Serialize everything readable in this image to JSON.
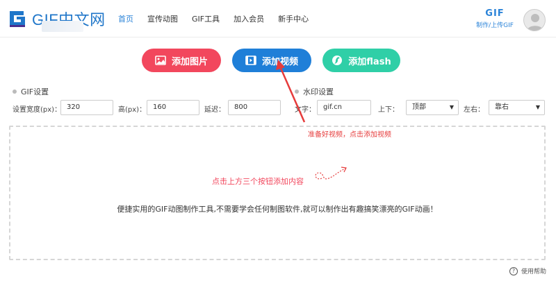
{
  "header": {
    "logo_text": "GIF中文网",
    "nav": [
      "首页",
      "宣传动图",
      "GIF工具",
      "加入会员",
      "新手中心"
    ],
    "active_nav": 0,
    "gif_title": "GIF",
    "gif_sub": "制作/上传GIF"
  },
  "actions": {
    "add_image": "添加图片",
    "add_video": "添加视频",
    "add_flash": "添加flash"
  },
  "gif_settings": {
    "title": "GIF设置",
    "width_label": "设置宽度(px)：",
    "width_value": "320",
    "height_label": "高(px)：",
    "height_value": "160",
    "delay_label": "延迟：",
    "delay_value": "800"
  },
  "watermark": {
    "title": "水印设置",
    "text_label": "文字：",
    "text_value": "gif.cn",
    "vertical_label": "上下：",
    "vertical_value": "顶部",
    "horizontal_label": "左右：",
    "horizontal_value": "靠右"
  },
  "annotations": {
    "video_note": "准备好视频，点击添加视频",
    "hint": "点击上方三个按钮添加内容"
  },
  "drop_area": {
    "description": "便捷实用的GIF动图制作工具,不需要学会任何制图软件,就可以制作出有趣搞笑漂亮的GIF动画！"
  },
  "help": "使用帮助",
  "colors": {
    "brand": "#1f76c9",
    "image_btn": "#f2475d",
    "video_btn": "#1f7fd8",
    "flash_btn": "#2fcfa7",
    "annotation": "#e63c3c"
  }
}
